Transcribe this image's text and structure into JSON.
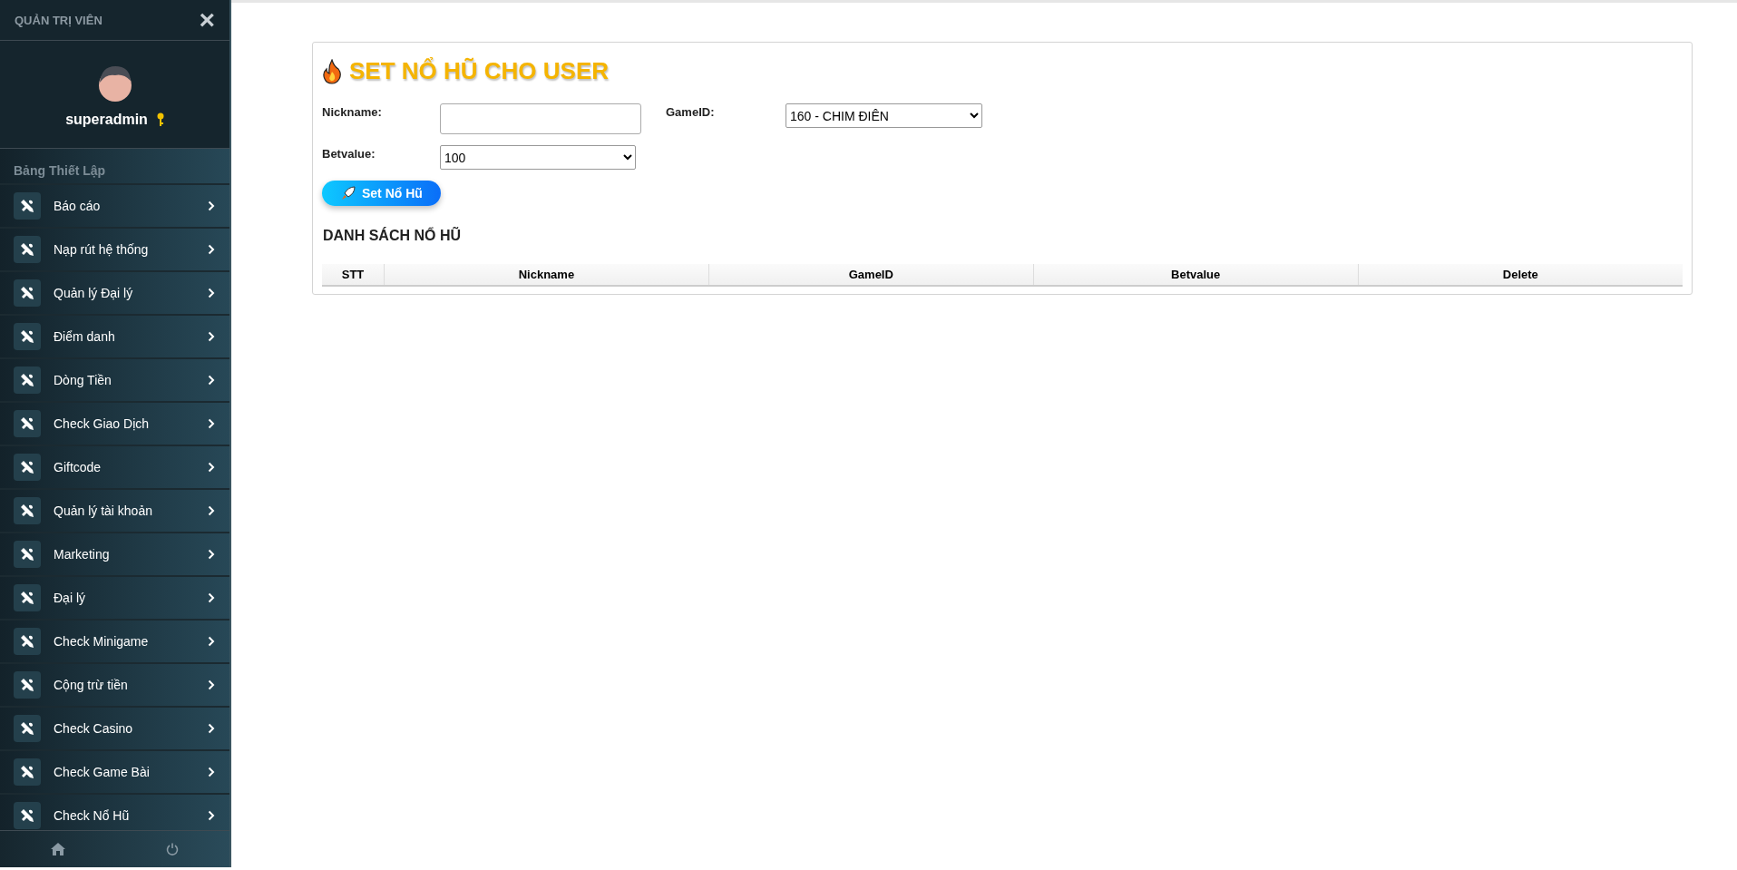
{
  "sidebar": {
    "title": "QUẢN TRỊ VIÊN",
    "close": "×",
    "user": {
      "name": "superadmin"
    },
    "section": "Bảng Thiết Lập",
    "items": [
      {
        "label": "Báo cáo"
      },
      {
        "label": "Nạp rút hệ thống"
      },
      {
        "label": "Quản lý Đại lý"
      },
      {
        "label": "Điểm danh"
      },
      {
        "label": "Dòng Tiền"
      },
      {
        "label": "Check Giao Dịch"
      },
      {
        "label": "Giftcode"
      },
      {
        "label": "Quản lý tài khoản"
      },
      {
        "label": "Marketing"
      },
      {
        "label": "Đại lý"
      },
      {
        "label": "Check Minigame"
      },
      {
        "label": "Cộng trừ tiền"
      },
      {
        "label": "Check Casino"
      },
      {
        "label": "Check Game Bài"
      },
      {
        "label": "Check Nổ Hũ"
      }
    ]
  },
  "form": {
    "title": "SET NỔ HŨ CHO USER",
    "fields": [
      {
        "label": "Nickname:",
        "kind": "text"
      },
      {
        "label": "GameID:",
        "kind": "select",
        "value": "160 - CHIM ĐIÊN"
      },
      {
        "label": "Betvalue:",
        "kind": "select",
        "value": "100"
      }
    ],
    "submit": "Set Nổ Hũ"
  },
  "table": {
    "title": "DANH SÁCH NỔ HŨ",
    "columns": [
      "STT",
      "Nickname",
      "GameID",
      "Betvalue",
      "Delete"
    ]
  }
}
